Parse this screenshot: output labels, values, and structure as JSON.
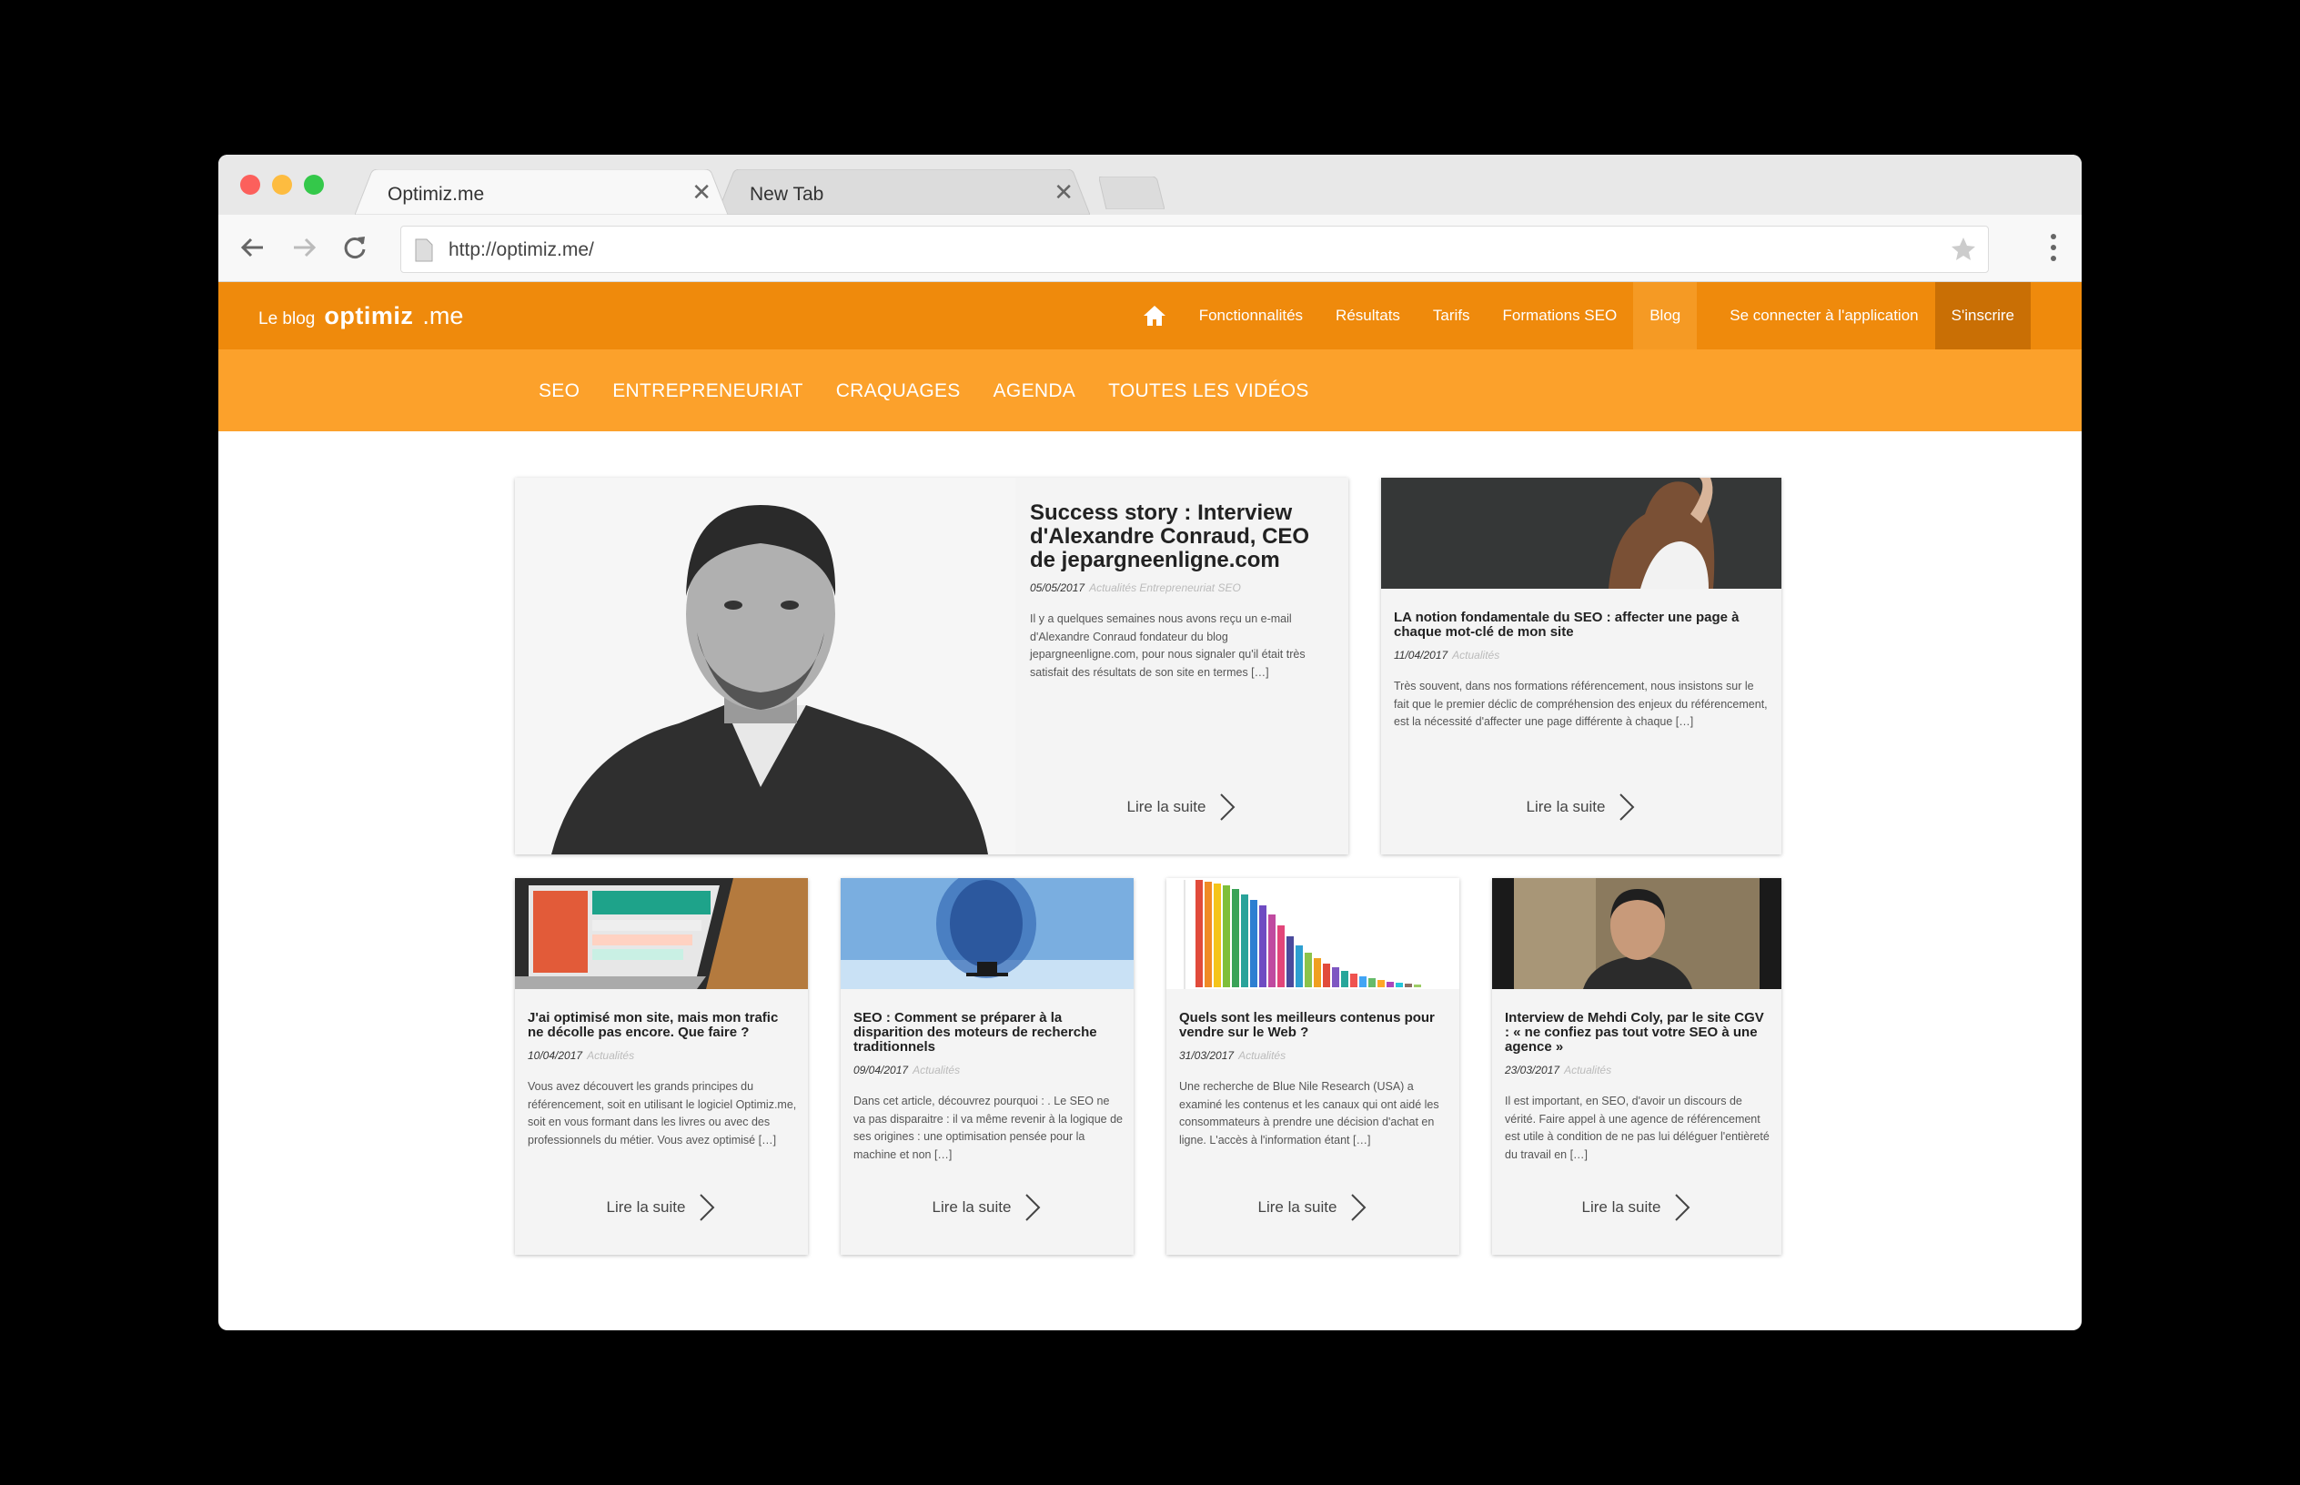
{
  "browser": {
    "tabs": [
      {
        "title": "Optimiz.me",
        "close": "✕"
      },
      {
        "title": "New Tab",
        "close": "✕"
      }
    ],
    "url": "http://optimiz.me/"
  },
  "site": {
    "brand_prefix": "Le blog",
    "brand_logo": "optimiz",
    "brand_logo_suffix": ".me",
    "nav": [
      "Fonctionnalités",
      "Résultats",
      "Tarifs",
      "Formations SEO",
      "Blog",
      "Se connecter à l'application",
      "S'inscrire"
    ],
    "subnav": [
      "SEO",
      "ENTREPRENEURIAT",
      "CRAQUAGES",
      "AGENDA",
      "TOUTES LES VIDÉOS"
    ],
    "read_more": "Lire la suite",
    "colors": {
      "header": "#ef8a0c",
      "subnav": "#fca12b"
    }
  },
  "articles": [
    {
      "title": "Success story : Interview d'Alexandre Conraud, CEO de jepargneenligne.com",
      "date": "05/05/2017",
      "categories": "Actualités  Entrepreneuriat  SEO",
      "excerpt": "Il y a quelques semaines nous avons reçu un e-mail d'Alexandre Conraud fondateur du blog jepargneenligne.com, pour nous signaler qu'il était très satisfait des résultats de son site en termes […]"
    },
    {
      "title": "LA notion fondamentale du SEO : affecter une page à chaque mot-clé de mon site",
      "date": "11/04/2017",
      "categories": "Actualités",
      "excerpt": "Très souvent, dans nos formations référencement, nous insistons sur le fait que le premier déclic de compréhension des enjeux du référencement, est la nécessité d'affecter une page différente à chaque […]"
    },
    {
      "title": "J'ai optimisé mon site, mais mon trafic ne décolle pas encore. Que faire ?",
      "date": "10/04/2017",
      "categories": "Actualités",
      "excerpt": "Vous avez découvert les grands principes du référencement, soit en utilisant le logiciel Optimiz.me, soit en vous formant dans les livres ou avec des professionnels du métier. Vous avez optimisé […]"
    },
    {
      "title": "SEO : Comment se préparer à la disparition des moteurs de recherche traditionnels",
      "date": "09/04/2017",
      "categories": "Actualités",
      "excerpt": "Dans cet article, découvrez pourquoi : . Le SEO ne va pas disparaitre : il va même revenir à la logique de ses origines : une optimisation pensée pour la machine et non […]"
    },
    {
      "title": "Quels sont les meilleurs contenus pour vendre sur le Web ?",
      "date": "31/03/2017",
      "categories": "Actualités",
      "excerpt": "Une recherche de Blue Nile Research (USA) a examiné les contenus et les canaux qui ont aidé les consommateurs à prendre une décision d'achat en ligne. L'accès à l'information étant […]"
    },
    {
      "title": "Interview de Mehdi Coly, par le site CGV : « ne confiez pas tout votre SEO à une agence »",
      "date": "23/03/2017",
      "categories": "Actualités",
      "excerpt": "Il est important, en SEO, d'avoir un discours de vérité. Faire appel à une agence de référencement est utile à condition de ne pas lui déléguer l'entièreté du travail en […]"
    }
  ]
}
